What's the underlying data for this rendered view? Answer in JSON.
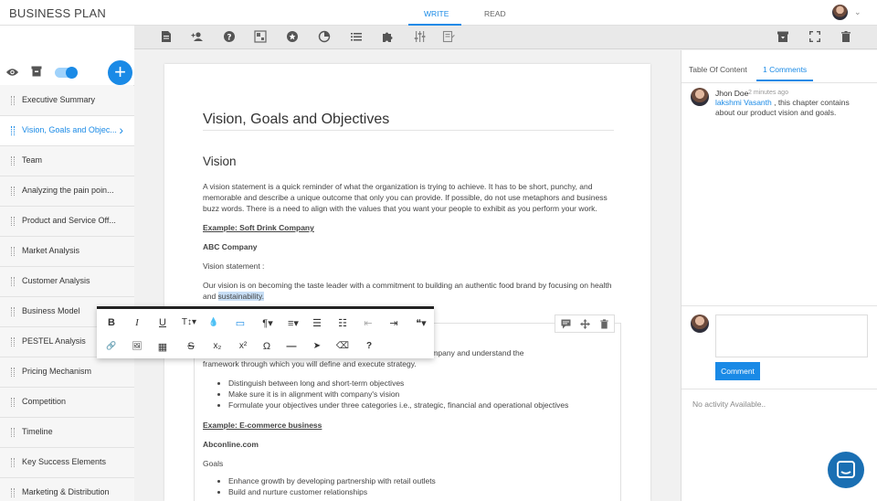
{
  "app": {
    "title": "BUSINESS PLAN"
  },
  "modes": {
    "write": "WRITE",
    "read": "READ"
  },
  "sidebar": {
    "items": [
      {
        "label": "Executive Summary"
      },
      {
        "label": "Vision, Goals and Objec..."
      },
      {
        "label": "Team"
      },
      {
        "label": "Analyzing the pain poin..."
      },
      {
        "label": "Product and Service Off..."
      },
      {
        "label": "Market Analysis"
      },
      {
        "label": "Customer Analysis"
      },
      {
        "label": "Business Model"
      },
      {
        "label": "PESTEL Analysis"
      },
      {
        "label": "Pricing Mechanism"
      },
      {
        "label": "Competition"
      },
      {
        "label": "Timeline"
      },
      {
        "label": "Key Success Elements"
      },
      {
        "label": "Marketing & Distribution"
      }
    ],
    "add_label": "+"
  },
  "document": {
    "title": "Vision, Goals and Objectives",
    "vision_heading": "Vision",
    "vision_para": "A vision statement is a quick reminder of what the organization is trying to achieve. It has to be short, punchy, and memorable and describe a unique outcome that only you can provide. If possible, do not use metaphors and business buzz words. There is a need to align with the values that you want your people to exhibit as you perform your work.",
    "example1": "Example: Soft Drink Company",
    "company1": "ABC Company",
    "vision_statement_label": "Vision statement :",
    "vision_statement_text": "Our vision is on becoming the taste leader with a commitment to building an authentic food brand by focusing on health and ",
    "vision_highlight": "sustainability.",
    "goals_para_tail": "ystem of your company and understand the",
    "goals_para_line2": "framework through which you will define and execute strategy.",
    "goals_bullets": [
      "Distinguish between long and short-term objectives",
      "Make sure it is in alignment with company's vision",
      "Formulate your objectives under three categories i.e., strategic, financial and operational objectives"
    ],
    "example2": "Example: E-commerce business",
    "company2": "Abconline.com",
    "goals_label": "Goals",
    "goals_list": [
      "Enhance  growth by developing partnership with retail outlets",
      "Build and nurture customer relationships"
    ]
  },
  "format_bar": {
    "row1": [
      "B",
      "I",
      "U",
      "T↕▾",
      "💧",
      "▭",
      "¶▾",
      "≡▾",
      "☰",
      "☷",
      "⇤",
      "⇥",
      "❝▾"
    ],
    "row2": [
      "🔗",
      "🖼",
      "▦",
      "S",
      "x₂",
      "x²",
      "Ω",
      "—",
      "➤",
      "⌫",
      "?"
    ]
  },
  "right_panel": {
    "tab_toc": "Table Of Content",
    "tab_comments": "1 Comments",
    "comment": {
      "author": "Jhon Doe",
      "time": "2 minutes ago",
      "mention": "lakshmi Vasanth",
      "text": " , this chapter contains about our product vision and goals."
    },
    "comment_button": "Comment",
    "no_activity": "No activity Available.."
  },
  "colors": {
    "accent": "#1a8ae6",
    "chat": "#1a6fb3"
  }
}
